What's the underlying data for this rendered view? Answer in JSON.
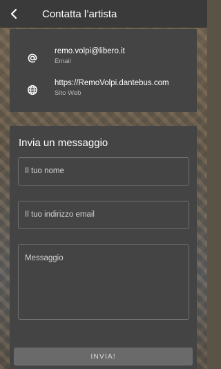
{
  "header": {
    "title": "Contatta l’artista",
    "back_icon": "chevron-left-icon"
  },
  "contacts": [
    {
      "icon": "at-sign-icon",
      "value": "remo.volpi@libero.it",
      "label": "Email"
    },
    {
      "icon": "globe-icon",
      "value": "https://RemoVolpi.dantebus.com",
      "label": "Sito Web"
    }
  ],
  "form": {
    "title": "Invia un messaggio",
    "name_placeholder": "Il tuo nome",
    "email_placeholder": "Il tuo indirizzo email",
    "message_placeholder": "Messaggio",
    "send_label": "INVIA!"
  },
  "colors": {
    "topbar": "#3a3a3a",
    "card": "#444444",
    "button": "#6a6a6a"
  }
}
